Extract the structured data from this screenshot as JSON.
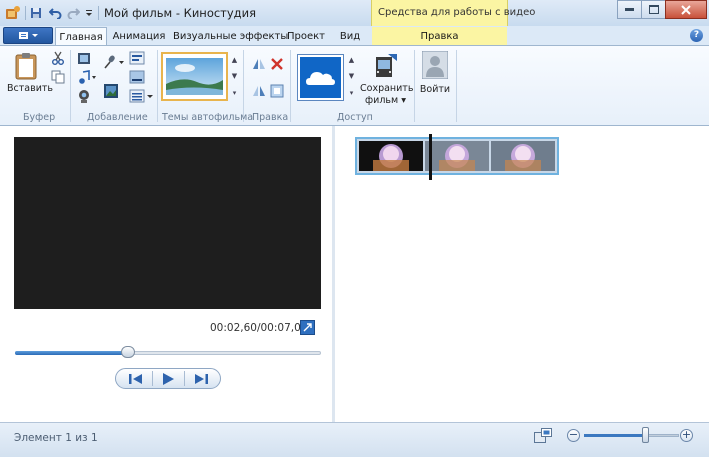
{
  "window": {
    "title": "Мой фильм - Киностудия",
    "context_tab_title": "Средства для работы с видео"
  },
  "tabs": [
    {
      "label": "Главная",
      "active": true
    },
    {
      "label": "Анимация",
      "active": false
    },
    {
      "label": "Визуальные эффекты",
      "active": false
    },
    {
      "label": "Проект",
      "active": false
    },
    {
      "label": "Вид",
      "active": false
    },
    {
      "label": "Правка",
      "active": false,
      "context": true
    }
  ],
  "ribbon": {
    "groups": [
      {
        "label": "Буфер"
      },
      {
        "label": "Добавление"
      },
      {
        "label": "Темы автофильма"
      },
      {
        "label": "Правка"
      },
      {
        "label": "Доступ"
      }
    ],
    "paste_label": "Вставить",
    "save_movie_label": "Сохранить фильм",
    "save_movie_line1": "Сохранить",
    "save_movie_line2": "фильм",
    "sign_in_label": "Войти"
  },
  "preview": {
    "timecode": "00:02,60/00:07,00",
    "position_fraction": 0.37
  },
  "status": {
    "text": "Элемент 1 из 1",
    "zoom_fraction": 0.64
  },
  "colors": {
    "accent": "#2b6bb7",
    "context": "#fbf5a3",
    "video_bg": "#1e1e1e"
  }
}
